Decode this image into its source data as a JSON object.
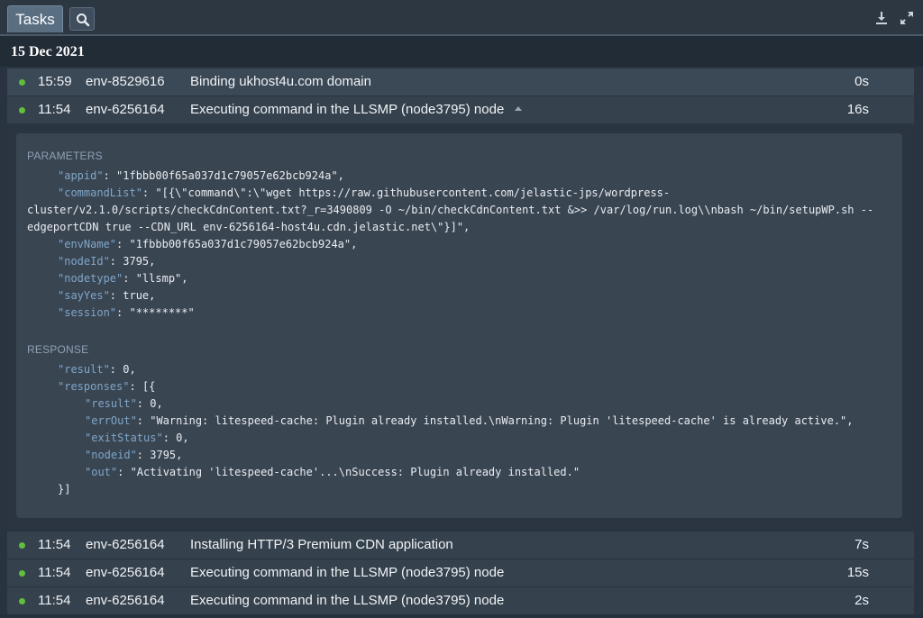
{
  "toolbar": {
    "tab_label": "Tasks",
    "icons": [
      "search-icon",
      "download-icon",
      "expand-icon"
    ]
  },
  "date_header": "15 Dec 2021",
  "tasks": [
    {
      "time": "15:59",
      "env": "env-8529616",
      "description": "Binding ukhost4u.com domain",
      "duration": "0s"
    },
    {
      "time": "11:54",
      "env": "env-6256164",
      "description": "Executing command in the LLSMP (node3795) node",
      "duration": "16s",
      "expanded": true
    },
    {
      "time": "11:54",
      "env": "env-6256164",
      "description": "Installing HTTP/3 Premium CDN application",
      "duration": "7s"
    },
    {
      "time": "11:54",
      "env": "env-6256164",
      "description": "Executing command in the LLSMP (node3795) node",
      "duration": "15s"
    },
    {
      "time": "11:54",
      "env": "env-6256164",
      "description": "Executing command in the LLSMP (node3795) node",
      "duration": "2s"
    }
  ],
  "details": {
    "parameters_label": "PARAMETERS",
    "response_label": "RESPONSE",
    "parameters": {
      "appid_key": "\"appid\"",
      "appid_val": "\"1fbbb00f65a037d1c79057e62bcb924a\",",
      "commandList_key": "\"commandList\"",
      "commandList_val1": "\"[{\\\"command\\\":\\\"wget https://raw.githubusercontent.com/jelastic-jps/wordpress-",
      "commandList_val2": "cluster/v2.1.0/scripts/checkCdnContent.txt?_r=3490809 -O ~/bin/checkCdnContent.txt &>> /var/log/run.log\\\\nbash ~/bin/setupWP.sh --",
      "commandList_val3": "edgeportCDN true --CDN_URL env-6256164-host4u.cdn.jelastic.net\\\"}]\",",
      "envName_key": "\"envName\"",
      "envName_val": "\"1fbbb00f65a037d1c79057e62bcb924a\",",
      "nodeId_key": "\"nodeId\"",
      "nodeId_val": "3795,",
      "nodetype_key": "\"nodetype\"",
      "nodetype_val": "\"llsmp\",",
      "sayYes_key": "\"sayYes\"",
      "sayYes_val": "true,",
      "session_key": "\"session\"",
      "session_val": "\"********\""
    },
    "response": {
      "result_key": "\"result\"",
      "result_val": "0,",
      "responses_key": "\"responses\"",
      "responses_open": "[{",
      "r_result_key": "\"result\"",
      "r_result_val": "0,",
      "errOut_key": "\"errOut\"",
      "errOut_val": "\"Warning: litespeed-cache: Plugin already installed.\\nWarning: Plugin 'litespeed-cache' is already active.\",",
      "exitStatus_key": "\"exitStatus\"",
      "exitStatus_val": "0,",
      "nodeid_key": "\"nodeid\"",
      "nodeid_val": "3795,",
      "out_key": "\"out\"",
      "out_val": "\"Activating 'litespeed-cache'...\\nSuccess: Plugin already installed.\"",
      "responses_close": "}]"
    }
  }
}
